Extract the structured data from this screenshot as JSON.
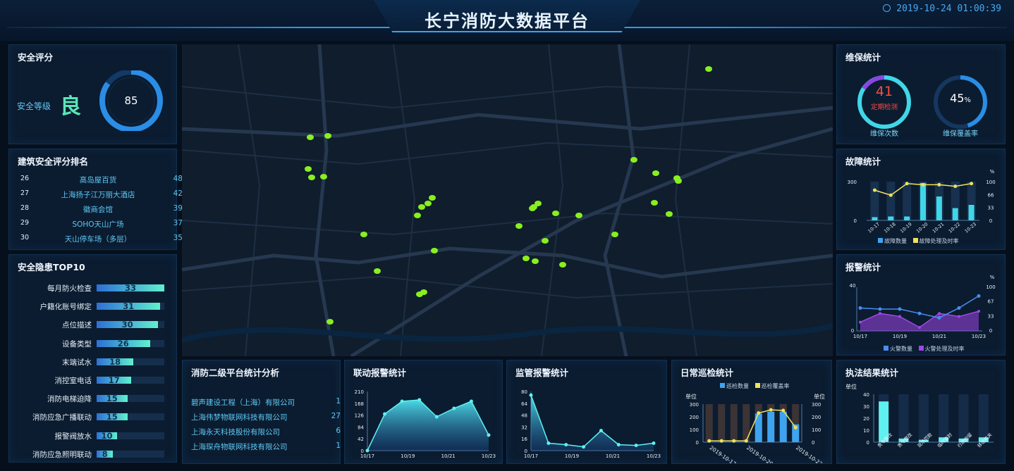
{
  "header": {
    "title": "长宁消防大数据平台",
    "datetime": "2019-10-24 01:00:39"
  },
  "safety_score": {
    "title": "安全评分",
    "level_label": "安全等级",
    "level_value": "良",
    "score": "85",
    "score_fraction": 0.85
  },
  "building_ranking": {
    "title": "建筑安全评分排名",
    "rows": [
      {
        "no": "26",
        "name": "高岛屋百货",
        "score": "48"
      },
      {
        "no": "27",
        "name": "上海扬子江万丽大酒店",
        "score": "42"
      },
      {
        "no": "28",
        "name": "徽商会馆",
        "score": "39"
      },
      {
        "no": "29",
        "name": "SOHO天山广场",
        "score": "37"
      },
      {
        "no": "30",
        "name": "天山停车场（多层）",
        "score": "35"
      }
    ]
  },
  "hazard_top10": {
    "title": "安全隐患TOP10",
    "max": 33,
    "rows": [
      {
        "label": "每月防火检查",
        "value": "33"
      },
      {
        "label": "户籍化账号绑定",
        "value": "31"
      },
      {
        "label": "点位描述",
        "value": "30"
      },
      {
        "label": "设备类型",
        "value": "26"
      },
      {
        "label": "末端试水",
        "value": "18"
      },
      {
        "label": "消控室电话",
        "value": "17"
      },
      {
        "label": "消防电梯迫降",
        "value": "15"
      },
      {
        "label": "消防应急广播联动",
        "value": "15"
      },
      {
        "label": "报警阀放水",
        "value": "10"
      },
      {
        "label": "消防应急照明联动",
        "value": "8"
      }
    ]
  },
  "maintenance": {
    "title": "维保统计",
    "count_value": "41",
    "count_sub": "定期检测",
    "count_label": "维保次数",
    "coverage_value": "45",
    "coverage_unit": "%",
    "coverage_label": "维保覆盖率",
    "coverage_fraction": 0.45
  },
  "fault_stats": {
    "title": "故障统计",
    "legend_bar": "故障数量",
    "legend_line": "故障处理及时率",
    "right_unit": "%",
    "colors": {
      "bar": "#3fd7e8",
      "line": "#f2e15a"
    }
  },
  "alarm_stats": {
    "title": "报警统计",
    "legend_a": "火警数量",
    "legend_b": "火警处理及时率",
    "right_unit": "%",
    "colors": {
      "a": "#4a8cf0",
      "b": "#a146e8"
    }
  },
  "platform_analysis": {
    "title": "消防二级平台统计分析",
    "rows": [
      {
        "name": "碧声建设工程（上海）有限公司",
        "value": "1"
      },
      {
        "name": "上海伟梦物联网科技有限公司",
        "value": "27"
      },
      {
        "name": "上海永天科技股份有限公司",
        "value": "6"
      },
      {
        "name": "上海琛舟物联网科技有限公司",
        "value": "1"
      }
    ]
  },
  "linked_alarm": {
    "title": "联动报警统计"
  },
  "monitor_alarm": {
    "title": "监管报警统计"
  },
  "daily_patrol": {
    "title": "日常巡检统计",
    "legend_bar": "巡检数量",
    "legend_line": "巡检覆盖率",
    "left_unit": "单位",
    "right_unit": "单位"
  },
  "enforcement": {
    "title": "执法结果统计",
    "unit": "单位",
    "categories": [
      "责令整改",
      "责令整改",
      "现场罚款",
      "临时查封",
      "行政拘留",
      "移送机关"
    ]
  },
  "chart_data": [
    {
      "type": "bar",
      "title": "故障统计",
      "categories": [
        "10-17",
        "10-18",
        "10-19",
        "10-20",
        "10-21",
        "10-22",
        "10-23"
      ],
      "ylim": [
        0,
        300
      ],
      "y2lim": [
        0,
        100
      ],
      "yticks": [
        "300",
        "0"
      ],
      "y2ticks": [
        "100",
        "66",
        "33",
        "0"
      ],
      "series": [
        {
          "name": "故障数量",
          "values": [
            25,
            30,
            30,
            290,
            185,
            95,
            120
          ]
        },
        {
          "name": "故障处理及时率",
          "values": [
            78,
            65,
            95,
            92,
            92,
            88,
            95
          ]
        }
      ]
    },
    {
      "type": "area",
      "title": "报警统计",
      "categories": [
        "10/17",
        "10/18",
        "10/19",
        "10/20",
        "10/21",
        "10/22",
        "10/23"
      ],
      "ylim": [
        0,
        40
      ],
      "y2lim": [
        0,
        100
      ],
      "yticks": [
        "40",
        "0"
      ],
      "y2ticks": [
        "100",
        "67",
        "33",
        "0"
      ],
      "series": [
        {
          "name": "火警数量",
          "values": [
            21,
            20,
            20,
            16,
            12,
            21,
            32
          ]
        },
        {
          "name": "火警处理及时率",
          "values": [
            20,
            40,
            33,
            8,
            40,
            33,
            45
          ]
        }
      ]
    },
    {
      "type": "area",
      "title": "联动报警统计",
      "categories": [
        "10/17",
        "10/19",
        "10/21",
        "10/23"
      ],
      "ylim": [
        0,
        210
      ],
      "yticks": [
        "210",
        "168",
        "126",
        "84",
        "42",
        "0"
      ],
      "series": [
        {
          "name": "",
          "values": [
            0,
            130,
            175,
            180,
            120,
            150,
            175,
            55
          ]
        }
      ]
    },
    {
      "type": "area",
      "title": "监管报警统计",
      "categories": [
        "10/17",
        "10/19",
        "10/21",
        "10/23"
      ],
      "ylim": [
        0,
        80
      ],
      "yticks": [
        "80",
        "64",
        "48",
        "32",
        "16",
        "0"
      ],
      "series": [
        {
          "name": "",
          "values": [
            75,
            10,
            8,
            5,
            27,
            8,
            7,
            10
          ]
        }
      ]
    },
    {
      "type": "bar",
      "title": "日常巡检统计",
      "categories": [
        "2019-10-17",
        "",
        "",
        "2019-10-20",
        "",
        "",
        "2019-10-23"
      ],
      "ylim": [
        0,
        300
      ],
      "yticks": [
        "300",
        "200",
        "100",
        "0"
      ],
      "series": [
        {
          "name": "巡检数量",
          "values": [
            0,
            0,
            0,
            0,
            225,
            240,
            240,
            140
          ]
        },
        {
          "name": "巡检覆盖率",
          "values": [
            10,
            10,
            10,
            10,
            230,
            255,
            250,
            115
          ]
        }
      ]
    },
    {
      "type": "bar",
      "title": "执法结果统计",
      "categories": [
        "责令整改",
        "责令整改",
        "现场罚款",
        "临时查封",
        "行政拘留",
        "移送机关"
      ],
      "ylim": [
        0,
        40
      ],
      "yticks": [
        "40",
        "30",
        "20",
        "10",
        "0"
      ],
      "series": [
        {
          "name": "",
          "values": [
            34,
            3,
            2,
            4,
            3,
            4
          ]
        }
      ]
    }
  ]
}
